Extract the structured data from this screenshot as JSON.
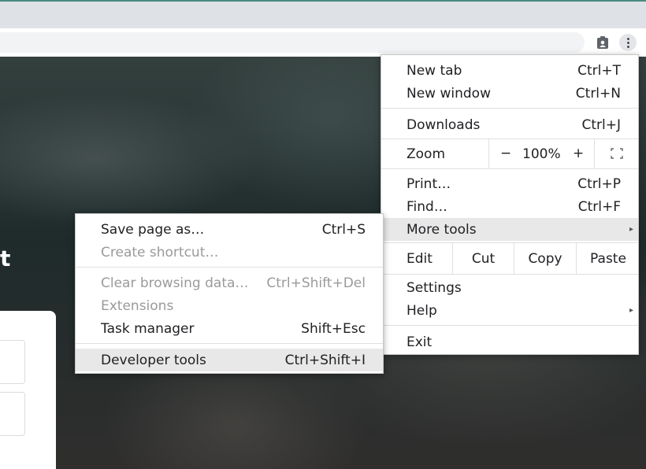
{
  "main_menu": {
    "new_tab": {
      "label": "New tab",
      "shortcut": "Ctrl+T"
    },
    "new_window": {
      "label": "New window",
      "shortcut": "Ctrl+N"
    },
    "downloads": {
      "label": "Downloads",
      "shortcut": "Ctrl+J"
    },
    "zoom": {
      "label": "Zoom",
      "minus": "−",
      "value": "100%",
      "plus": "+"
    },
    "print": {
      "label": "Print…",
      "shortcut": "Ctrl+P"
    },
    "find": {
      "label": "Find…",
      "shortcut": "Ctrl+F"
    },
    "more_tools": {
      "label": "More tools"
    },
    "edit": {
      "label": "Edit",
      "cut": "Cut",
      "copy": "Copy",
      "paste": "Paste"
    },
    "settings": {
      "label": "Settings"
    },
    "help": {
      "label": "Help"
    },
    "exit": {
      "label": "Exit"
    }
  },
  "more_tools_menu": {
    "save_page_as": {
      "label": "Save page as…",
      "shortcut": "Ctrl+S"
    },
    "create_shortcut": {
      "label": "Create shortcut…"
    },
    "clear_browsing_data": {
      "label": "Clear browsing data…",
      "shortcut": "Ctrl+Shift+Del"
    },
    "extensions": {
      "label": "Extensions"
    },
    "task_manager": {
      "label": "Task manager",
      "shortcut": "Shift+Esc"
    },
    "developer_tools": {
      "label": "Developer tools",
      "shortcut": "Ctrl+Shift+I"
    }
  },
  "page": {
    "heading_fragment": "t"
  },
  "icons": {
    "extension": "clipboard-person-icon",
    "menu": "three-dots-vertical-icon",
    "submenu_arrow": "triangle-right-icon",
    "fullscreen": "fullscreen-corners-icon"
  },
  "colors": {
    "highlight": "#e8e8e8",
    "disabled_text": "#9a9a9a",
    "tabstrip": "#dee1e6"
  }
}
